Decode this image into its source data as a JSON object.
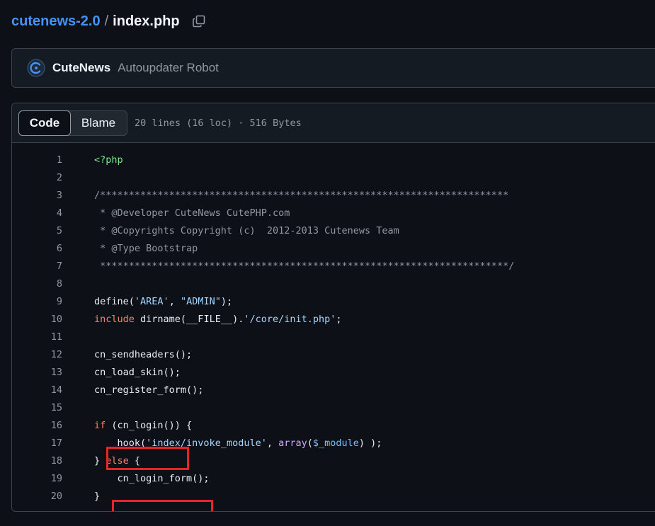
{
  "breadcrumb": {
    "repo": "cutenews-2.0",
    "separator": "/",
    "file": "index.php"
  },
  "commit": {
    "author": "CuteNews",
    "message": "Autoupdater Robot"
  },
  "file_header": {
    "tabs": [
      "Code",
      "Blame"
    ],
    "active_tab": "Code",
    "meta": "20 lines (16 loc) · 516 Bytes"
  },
  "code": {
    "line_numbers": [
      "1",
      "2",
      "3",
      "4",
      "5",
      "6",
      "7",
      "8",
      "9",
      "10",
      "11",
      "12",
      "13",
      "14",
      "15",
      "16",
      "17",
      "18",
      "19",
      "20"
    ],
    "lines": {
      "l1": "<?php",
      "l3": "/***********************************************************************",
      "l4": " * @Developer CuteNews CutePHP.com",
      "l5": " * @Copyrights Copyright (c)  2012-2013 Cutenews Team",
      "l6": " * @Type Bootstrap",
      "l7": " ***********************************************************************/",
      "l9_a": "define(",
      "l9_b": "'AREA'",
      "l9_c": ", ",
      "l9_d": "\"ADMIN\"",
      "l9_e": ");",
      "l10_a": "include",
      "l10_b": " dirname(__FILE__).",
      "l10_c": "'/core/init.php'",
      "l10_d": ";",
      "l12": "cn_sendheaders();",
      "l13": "cn_load_skin();",
      "l14": "cn_register_form();",
      "l16_a": "if",
      "l16_b": " (cn_login()) {",
      "l17_a": "    hook(",
      "l17_b": "'index/invoke_module'",
      "l17_c": ", ",
      "l17_d": "array",
      "l17_e": "(",
      "l17_f": "$_module",
      "l17_g": ") );",
      "l18_a": "} ",
      "l18_b": "else",
      "l18_c": " {",
      "l19": "    cn_login_form();",
      "l20": "}"
    }
  },
  "colors": {
    "highlight_box": "#e5252a",
    "keyword": "#ff7b72",
    "string": "#a5d6ff",
    "comment": "#9198a1"
  },
  "icons": {
    "copy": "copy-icon",
    "avatar": "cutenews-avatar-icon"
  }
}
